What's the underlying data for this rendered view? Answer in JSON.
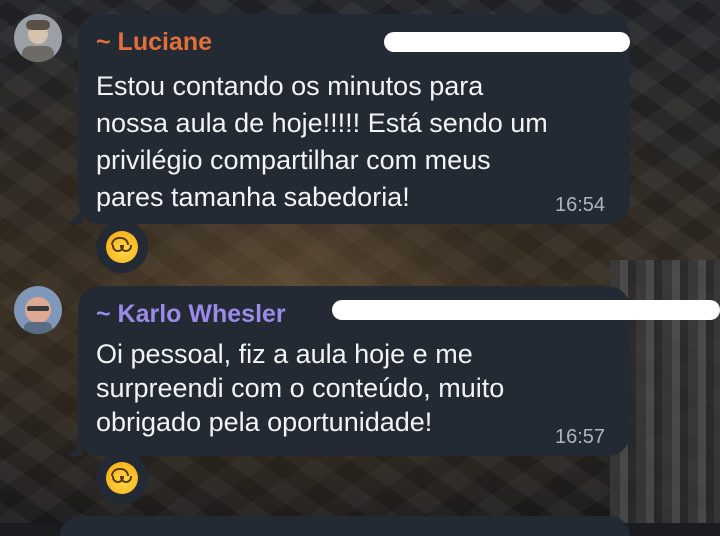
{
  "messages": [
    {
      "sender": "~ Luciane",
      "sender_color": "#e0703a",
      "lines": [
        "Estou contando os minutos para",
        "nossa aula de hoje!!!!! Está sendo um",
        "privilégio compartilhar com meus",
        "pares tamanha sabedoria!"
      ],
      "time": "16:54",
      "reaction": "upside-down-face-emoji"
    },
    {
      "sender": "~ Karlo Whesler",
      "sender_color": "#9b8be8",
      "lines": [
        "Oi pessoal, fiz a aula hoje e me",
        "surpreendi com o conteúdo, muito",
        "obrigado pela oportunidade!"
      ],
      "time": "16:57",
      "reaction": "upside-down-face-emoji"
    }
  ]
}
